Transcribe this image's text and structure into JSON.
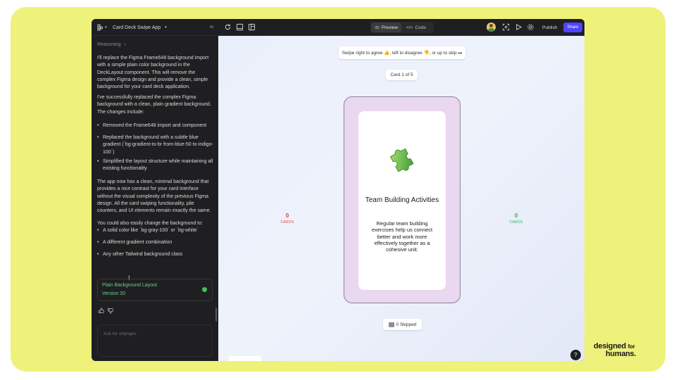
{
  "app": {
    "title": "Card Deck Swipe App",
    "ai_label": "AI"
  },
  "toolbar": {
    "preview_label": "Preview",
    "code_label": "Code",
    "publish_label": "Publish",
    "share_label": "Share"
  },
  "sidebar": {
    "reasoning_label": "Reasoning",
    "para1": "I'll replace the Figma Frame648 background import with a simple plain color background in the DeckLayout component. This will remove the complex Figma design and provide a clean, simple background for your card deck application.",
    "para2": "I've successfully replaced the complex Figma background with a clean, plain gradient background. The changes include:",
    "bullets1": [
      "Removed the Frame648 import and component",
      "Replaced the background with a subtle blue gradient (`bg-gradient-to-br from-blue-50 to-indigo-100`)",
      "Simplified the layout structure while maintaining all existing functionality"
    ],
    "para3": "The app now has a clean, minimal background that provides a nice contrast for your card interface without the visual complexity of the previous Figma design. All the card swiping functionality, pile counters, and UI elements remain exactly the same.",
    "para4": "You could also easily change the background to:",
    "bullets2": [
      "A solid color like `bg-gray-100` or `bg-white`",
      "A different gradient combination",
      "Any other Tailwind background class"
    ],
    "version_title": "Plain Background Layout",
    "version_sub": "Version 20",
    "chat_placeholder": "Ask for changes"
  },
  "main": {
    "instruction": "Swipe right to agree 👍, left to disagree 👎, or up to skip ⏭",
    "card_counter": "Card 1 of 5",
    "left_count": "0",
    "left_label": "CARDS",
    "right_count": "0",
    "right_label": "CARDS",
    "card_title": "Team Building Activities",
    "card_body": "Regular team building exercises help us connect better and work more effectively together as a cohesive unit.",
    "skipped": "0 Skipped",
    "disagree_count": "0",
    "agree_count": "0",
    "help": "?"
  },
  "brand": {
    "line1": "designed",
    "for": "for",
    "line2": "humans."
  },
  "colors": {
    "accent": "#4e44ff",
    "disagree": "#e0443e",
    "agree": "#2fae5a",
    "version_green": "#6fcf8a",
    "page_bg": "#eef27a"
  }
}
